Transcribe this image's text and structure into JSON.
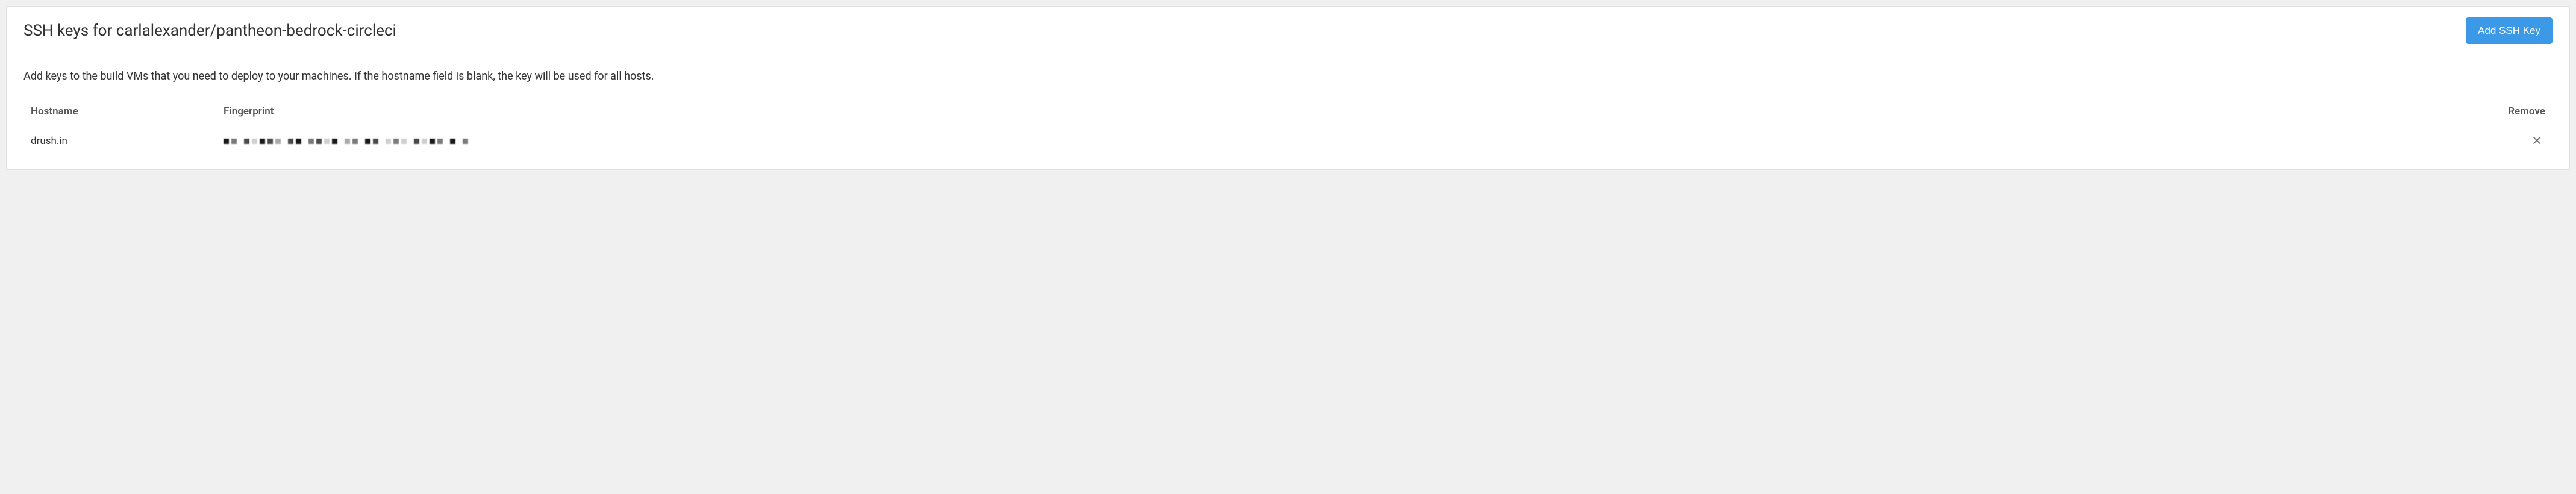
{
  "header": {
    "title": "SSH keys for carlalexander/pantheon-bedrock-circleci",
    "add_button_label": "Add SSH Key"
  },
  "description": "Add keys to the build VMs that you need to deploy to your machines. If the hostname field is blank, the key will be used for all hosts.",
  "table": {
    "columns": {
      "hostname": "Hostname",
      "fingerprint": "Fingerprint",
      "remove": "Remove"
    },
    "rows": [
      {
        "hostname": "drush.in",
        "fingerprint": "(redacted)"
      }
    ]
  }
}
